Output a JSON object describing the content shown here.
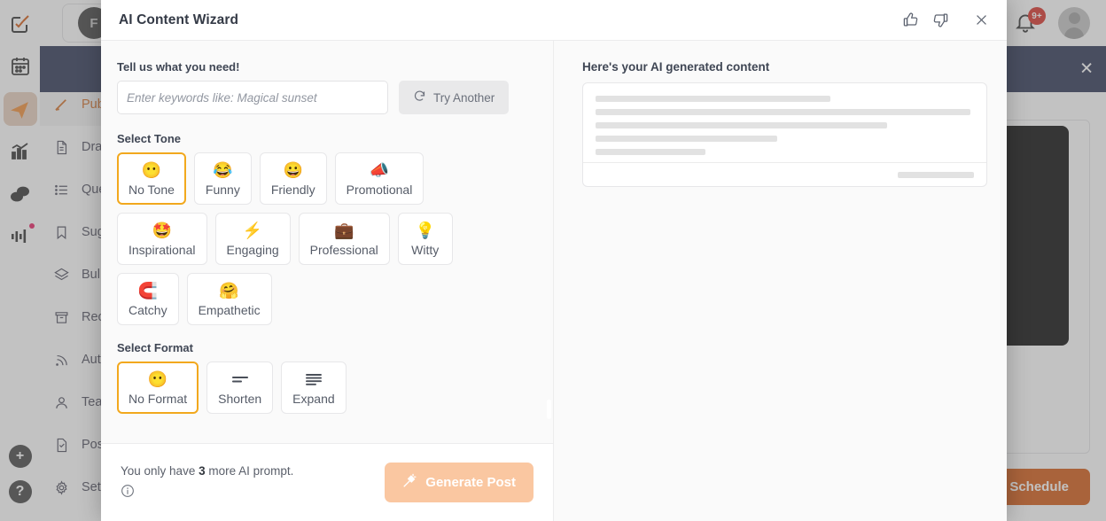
{
  "background": {
    "user_initial": "F",
    "notification_badge": "9+",
    "banner_close": "✕",
    "schedule_button": "Schedule",
    "nav_items": [
      {
        "label": "Publish",
        "icon": "pencil-icon",
        "active": true
      },
      {
        "label": "Drafts",
        "icon": "document-icon",
        "active": false
      },
      {
        "label": "Queue",
        "icon": "list-icon",
        "active": false
      },
      {
        "label": "Suggestions",
        "icon": "bookmark-icon",
        "active": false
      },
      {
        "label": "Bulk Upload",
        "icon": "layers-icon",
        "active": false
      },
      {
        "label": "Recycle",
        "icon": "archive-icon",
        "active": false
      },
      {
        "label": "Auto Post",
        "icon": "rss-icon",
        "active": false
      },
      {
        "label": "Team",
        "icon": "person-icon",
        "active": false
      },
      {
        "label": "Posts",
        "icon": "post-check-icon",
        "active": false
      },
      {
        "label": "Settings",
        "icon": "gear-icon",
        "active": false
      }
    ],
    "rail_icons": [
      "compose-icon",
      "calendar-icon",
      "publish-plane-icon",
      "analytics-icon",
      "messages-icon",
      "monitor-icon"
    ],
    "rail_bottom_icons": [
      "plus-icon",
      "help-icon"
    ]
  },
  "modal": {
    "title": "AI Content Wizard",
    "thumbs_up": "thumbs-up",
    "thumbs_down": "thumbs-down",
    "close": "✕",
    "left": {
      "prompt_label": "Tell us what you need!",
      "prompt_value": "",
      "prompt_placeholder": "Enter keywords like: Magical sunset",
      "try_another_label": "Try Another",
      "tone_label": "Select Tone",
      "tones": [
        {
          "label": "No Tone",
          "emoji": "😶",
          "selected": true
        },
        {
          "label": "Funny",
          "emoji": "😂",
          "selected": false
        },
        {
          "label": "Friendly",
          "emoji": "😀",
          "selected": false
        },
        {
          "label": "Promotional",
          "emoji": "📣",
          "selected": false
        },
        {
          "label": "Inspirational",
          "emoji": "🤩",
          "selected": false
        },
        {
          "label": "Engaging",
          "emoji": "⚡",
          "selected": false
        },
        {
          "label": "Professional",
          "emoji": "💼",
          "selected": false
        },
        {
          "label": "Witty",
          "emoji": "💡",
          "selected": false
        },
        {
          "label": "Catchy",
          "emoji": "🧲",
          "selected": false
        },
        {
          "label": "Empathetic",
          "emoji": "🤗",
          "selected": false
        }
      ],
      "format_label": "Select Format",
      "formats": [
        {
          "label": "No Format",
          "emoji": "😶",
          "icon": "",
          "selected": true
        },
        {
          "label": "Shorten",
          "emoji": "",
          "icon": "shorten-icon",
          "selected": false
        },
        {
          "label": "Expand",
          "emoji": "",
          "icon": "expand-icon",
          "selected": false
        }
      ],
      "quota_prefix": "You only have ",
      "quota_count": "3",
      "quota_suffix": " more AI prompt.",
      "generate_label": "Generate Post"
    },
    "right": {
      "title": "Here's your AI generated content",
      "skeleton_widths": [
        "62%",
        "99%",
        "77%",
        "48%",
        "29%"
      ]
    }
  },
  "colors": {
    "accent_orange": "#d2530a",
    "selected_border": "#f2a81d",
    "generate_bg": "#fac7a1",
    "banner_navy": "#232c4e",
    "badge_red": "#d8291f"
  }
}
